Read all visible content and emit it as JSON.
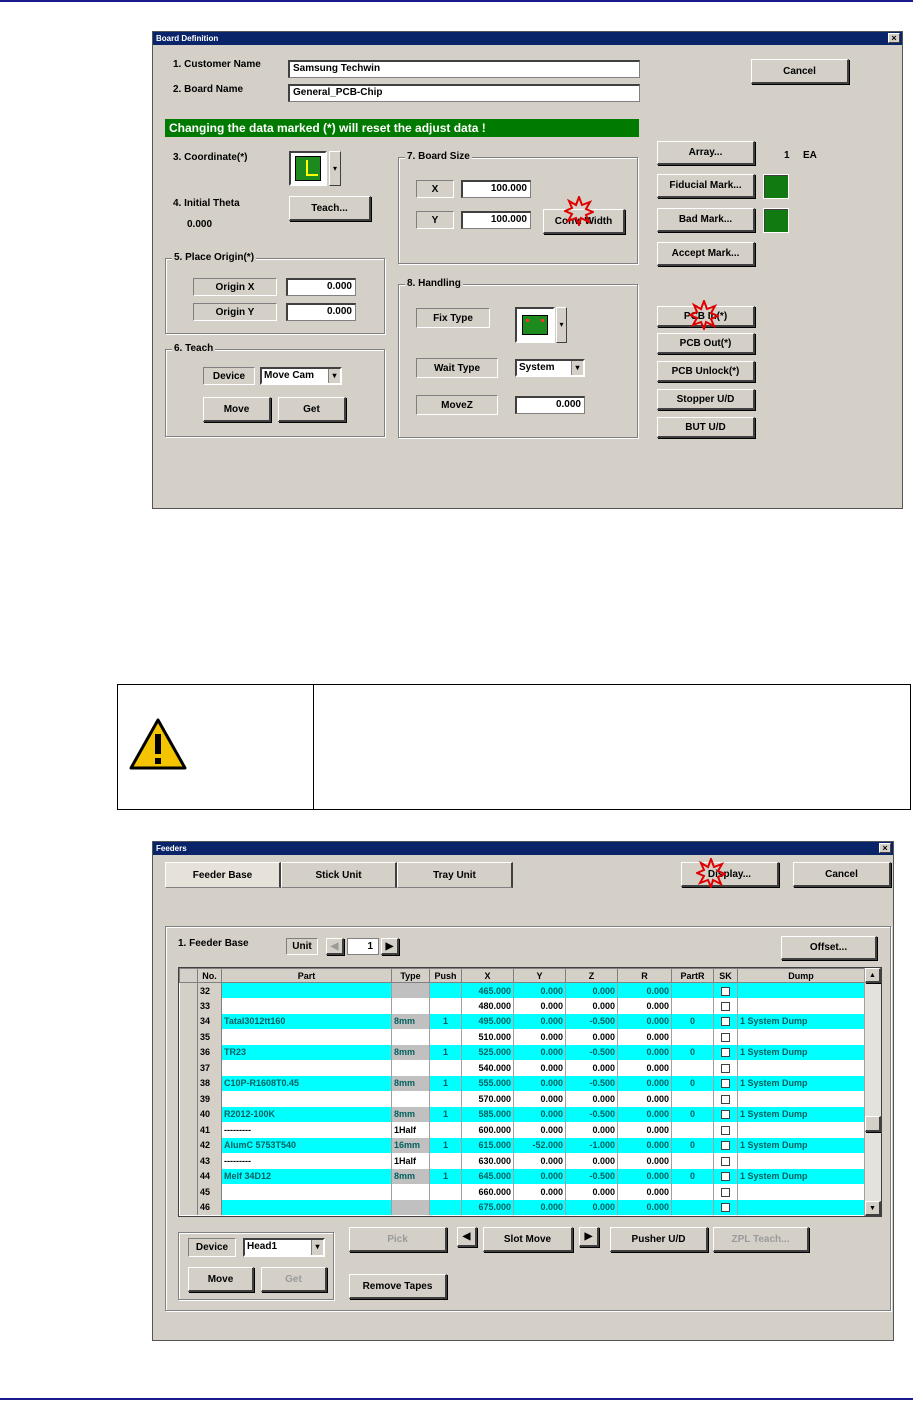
{
  "board_dialog": {
    "title": "Board Definition",
    "customer_name_label": "1. Customer Name",
    "customer_name_value": "Samsung Techwin",
    "board_name_label": "2. Board Name",
    "board_name_value": "General_PCB-Chip",
    "cancel_label": "Cancel",
    "warning_bar": "Changing the data marked (*) will reset the adjust data !",
    "coordinate_label": "3. Coordinate(*)",
    "initial_theta_label": "4. Initial Theta",
    "initial_theta_value": "0.000",
    "teach_button": "Teach...",
    "place_origin_label": "5. Place Origin(*)",
    "origin_x_label": "Origin X",
    "origin_x_value": "0.000",
    "origin_y_label": "Origin Y",
    "origin_y_value": "0.000",
    "teach_group_label": "6. Teach",
    "device_label": "Device",
    "device_value": "Move Cam",
    "move_button": "Move",
    "get_button": "Get",
    "board_size_label": "7. Board Size",
    "x_label": "X",
    "x_value": "100.000",
    "y_label": "Y",
    "y_value": "100.000",
    "conv_width_button": "Conv. Width",
    "handling_label": "8. Handling",
    "fix_type_label": "Fix Type",
    "wait_type_label": "Wait Type",
    "wait_type_value": "System",
    "movez_label": "MoveZ",
    "movez_value": "0.000",
    "array_button": "Array...",
    "array_count": "1",
    "array_unit": "EA",
    "fiducial_button": "Fiducial Mark...",
    "bad_mark_button": "Bad Mark...",
    "accept_mark_button": "Accept Mark...",
    "pcb_in_button": "PCB In(*)",
    "pcb_out_button": "PCB Out(*)",
    "pcb_unlock_button": "PCB Unlock(*)",
    "stopper_button": "Stopper U/D",
    "but_button": "BUT U/D"
  },
  "feeders_dialog": {
    "title": "Feeders",
    "tabs": [
      "Feeder Base",
      "Stick Unit",
      "Tray Unit"
    ],
    "display_button": "Display...",
    "cancel_button": "Cancel",
    "feeder_base_label": "1. Feeder Base",
    "unit_label": "Unit",
    "unit_value": "1",
    "offset_button": "Offset...",
    "columns": [
      "No.",
      "Part",
      "Type",
      "Push",
      "X",
      "Y",
      "Z",
      "R",
      "PartR",
      "SK",
      "Dump"
    ],
    "rows": [
      {
        "no": "32",
        "part": "",
        "type": "",
        "push": "",
        "x": "465.000",
        "y": "0.000",
        "z": "0.000",
        "r": "0.000",
        "partr": "",
        "dump": "",
        "hl": true
      },
      {
        "no": "33",
        "part": "",
        "type": "",
        "push": "",
        "x": "480.000",
        "y": "0.000",
        "z": "0.000",
        "r": "0.000",
        "partr": "",
        "dump": "",
        "hl": false
      },
      {
        "no": "34",
        "part": "Tatal3012tt160",
        "type": "8mm",
        "push": "1",
        "x": "495.000",
        "y": "0.000",
        "z": "-0.500",
        "r": "0.000",
        "partr": "0",
        "dump": "1 System Dump",
        "hl": true
      },
      {
        "no": "35",
        "part": "",
        "type": "",
        "push": "",
        "x": "510.000",
        "y": "0.000",
        "z": "0.000",
        "r": "0.000",
        "partr": "",
        "dump": "",
        "hl": false
      },
      {
        "no": "36",
        "part": "TR23",
        "type": "8mm",
        "push": "1",
        "x": "525.000",
        "y": "0.000",
        "z": "-0.500",
        "r": "0.000",
        "partr": "0",
        "dump": "1 System Dump",
        "hl": true
      },
      {
        "no": "37",
        "part": "",
        "type": "",
        "push": "",
        "x": "540.000",
        "y": "0.000",
        "z": "0.000",
        "r": "0.000",
        "partr": "",
        "dump": "",
        "hl": false
      },
      {
        "no": "38",
        "part": "C10P-R1608T0.45",
        "type": "8mm",
        "push": "1",
        "x": "555.000",
        "y": "0.000",
        "z": "-0.500",
        "r": "0.000",
        "partr": "0",
        "dump": "1 System Dump",
        "hl": true
      },
      {
        "no": "39",
        "part": "",
        "type": "",
        "push": "",
        "x": "570.000",
        "y": "0.000",
        "z": "0.000",
        "r": "0.000",
        "partr": "",
        "dump": "",
        "hl": false
      },
      {
        "no": "40",
        "part": "R2012-100K",
        "type": "8mm",
        "push": "1",
        "x": "585.000",
        "y": "0.000",
        "z": "-0.500",
        "r": "0.000",
        "partr": "0",
        "dump": "1 System Dump",
        "hl": true
      },
      {
        "no": "41",
        "part": "---------",
        "type": "1Half",
        "push": "",
        "x": "600.000",
        "y": "0.000",
        "z": "0.000",
        "r": "0.000",
        "partr": "",
        "dump": "",
        "hl": false
      },
      {
        "no": "42",
        "part": "AlumC 5753T540",
        "type": "16mm",
        "push": "1",
        "x": "615.000",
        "y": "-52.000",
        "z": "-1.000",
        "r": "0.000",
        "partr": "0",
        "dump": "1 System Dump",
        "hl": true
      },
      {
        "no": "43",
        "part": "---------",
        "type": "1Half",
        "push": "",
        "x": "630.000",
        "y": "0.000",
        "z": "0.000",
        "r": "0.000",
        "partr": "",
        "dump": "",
        "hl": false
      },
      {
        "no": "44",
        "part": "Melf 34D12",
        "type": "8mm",
        "push": "1",
        "x": "645.000",
        "y": "0.000",
        "z": "-0.500",
        "r": "0.000",
        "partr": "0",
        "dump": "1 System Dump",
        "hl": true
      },
      {
        "no": "45",
        "part": "",
        "type": "",
        "push": "",
        "x": "660.000",
        "y": "0.000",
        "z": "0.000",
        "r": "0.000",
        "partr": "",
        "dump": "",
        "hl": false
      },
      {
        "no": "46",
        "part": "",
        "type": "",
        "push": "",
        "x": "675.000",
        "y": "0.000",
        "z": "0.000",
        "r": "0.000",
        "partr": "",
        "dump": "",
        "hl": true
      }
    ],
    "device_label": "Device",
    "device_value": "Head1",
    "move_button": "Move",
    "get_button": "Get",
    "pick_button": "Pick",
    "slot_move_button": "Slot Move",
    "pusher_button": "Pusher U/D",
    "zpl_teach_button": "ZPL Teach...",
    "remove_tapes_button": "Remove Tapes"
  },
  "colors": {
    "title_bar": "#0a246a",
    "warning_green": "#007a00",
    "row_highlight": "#00ffff",
    "marker_red": "#e00000"
  }
}
